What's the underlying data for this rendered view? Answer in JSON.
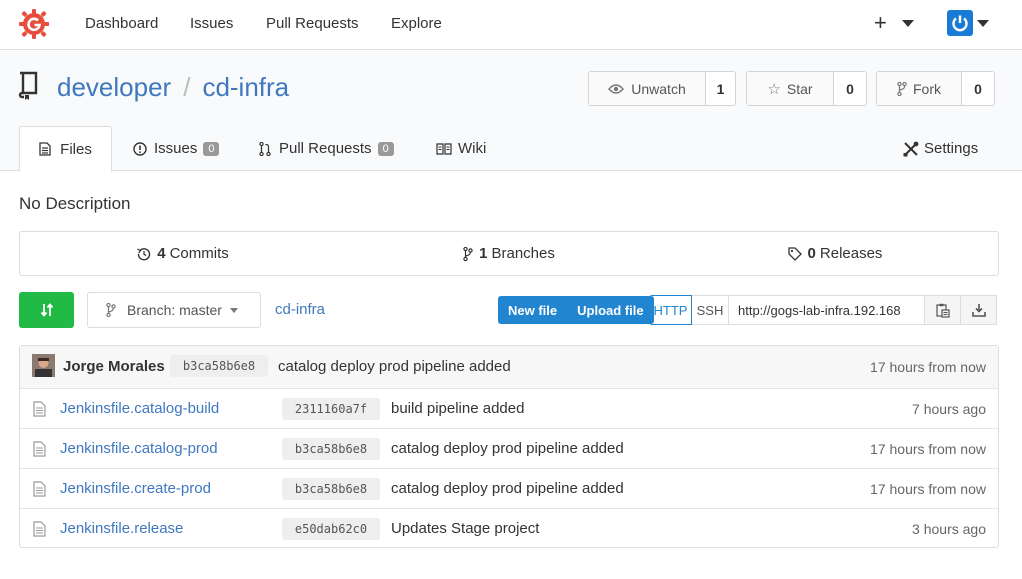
{
  "nav": {
    "dashboard": "Dashboard",
    "issues": "Issues",
    "pull_requests": "Pull Requests",
    "explore": "Explore",
    "plus": "+"
  },
  "repo": {
    "owner": "developer",
    "separator": "/",
    "name": "cd-infra",
    "unwatch_label": "Unwatch",
    "unwatch_count": "1",
    "star_label": "Star",
    "star_count": "0",
    "fork_label": "Fork",
    "fork_count": "0"
  },
  "tabs": {
    "files": "Files",
    "issues": "Issues",
    "issues_count": "0",
    "pull_requests": "Pull Requests",
    "pull_requests_count": "0",
    "wiki": "Wiki",
    "settings": "Settings"
  },
  "description": "No Description",
  "stats": {
    "commits_count": "4",
    "commits_label": "Commits",
    "branches_count": "1",
    "branches_label": "Branches",
    "releases_count": "0",
    "releases_label": "Releases"
  },
  "toolbar": {
    "branch_label": "Branch: master",
    "breadcrumb": "cd-infra",
    "new_file": "New file",
    "upload_file": "Upload file",
    "http": "HTTP",
    "ssh": "SSH",
    "clone_url": "http://gogs-lab-infra.192.168"
  },
  "latest_commit": {
    "author": "Jorge Morales",
    "sha": "b3ca58b6e8",
    "message": "catalog deploy prod pipeline added",
    "time": "17 hours from now"
  },
  "files": [
    {
      "name": "Jenkinsfile.catalog-build",
      "sha": "2311160a7f",
      "message": "build pipeline added",
      "time": "7 hours ago"
    },
    {
      "name": "Jenkinsfile.catalog-prod",
      "sha": "b3ca58b6e8",
      "message": "catalog deploy prod pipeline added",
      "time": "17 hours from now"
    },
    {
      "name": "Jenkinsfile.create-prod",
      "sha": "b3ca58b6e8",
      "message": "catalog deploy prod pipeline added",
      "time": "17 hours from now"
    },
    {
      "name": "Jenkinsfile.release",
      "sha": "e50dab62c0",
      "message": "Updates Stage project",
      "time": "3 hours ago"
    }
  ],
  "colors": {
    "link": "#4078c0",
    "logo": "#e74c3c",
    "sync_button": "#21ba45",
    "primary": "#2185d0"
  }
}
